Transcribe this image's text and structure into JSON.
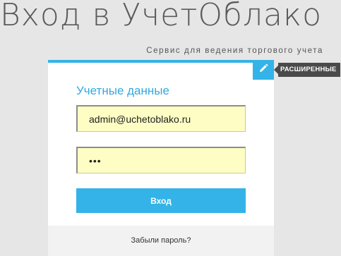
{
  "header": {
    "title": "Вход в УчетОблако",
    "subtitle": "Сервис для ведения торгового учета"
  },
  "login_form": {
    "section_title": "Учетные данные",
    "email_value": "admin@uchetoblako.ru",
    "password_value": "•••",
    "submit_label": "Вход",
    "forgot_password_label": "Забыли пароль?"
  },
  "advanced": {
    "icon": "pencil-icon",
    "label": "РАСШИРЕННЫЕ"
  },
  "colors": {
    "accent": "#33b3e8",
    "input_background": "#fdfdc4",
    "tooltip_background": "#4a4a4a",
    "page_background": "#e6e6e6"
  }
}
